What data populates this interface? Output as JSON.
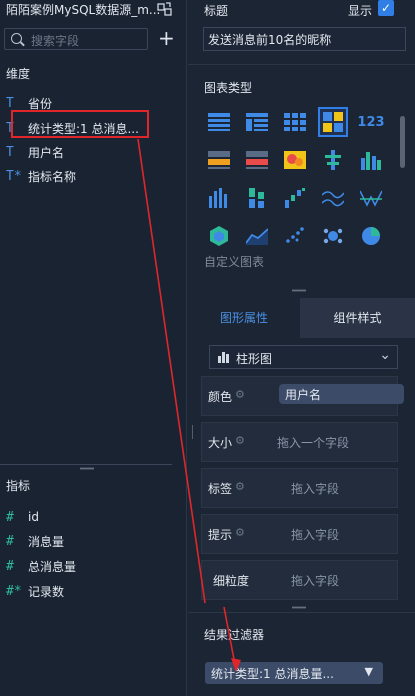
{
  "left_panel": {
    "datasource_title": "陌陌案例MySQL数据源_m...",
    "search_placeholder": "搜索字段",
    "add_label": "+",
    "dimensions_label": "维度",
    "dimensions": [
      {
        "icon": "T",
        "label": "省份"
      },
      {
        "icon": "T",
        "label": "统计类型:1 总消息..."
      },
      {
        "icon": "T",
        "label": "用户名"
      },
      {
        "icon": "T*",
        "label": "指标名称"
      }
    ],
    "measures_label": "指标",
    "measures": [
      {
        "icon": "#",
        "label": "id"
      },
      {
        "icon": "#",
        "label": "消息量"
      },
      {
        "icon": "#",
        "label": "总消息量"
      },
      {
        "icon": "#*",
        "label": "记录数"
      }
    ]
  },
  "right_panel": {
    "title_label": "标题",
    "show_label": "显示",
    "show_checked": true,
    "title_value": "发送消息前10名的昵称",
    "chart_type_label": "图表类型",
    "custom_chart_label": "自定义图表",
    "selected_chart_index": 4,
    "tabs": [
      "图形属性",
      "组件样式"
    ],
    "chart_select_value": "柱形图",
    "shelves": {
      "color_label": "颜色",
      "color_value": "用户名",
      "size_label": "大小",
      "size_hint": "拖入一个字段",
      "label_label": "标签",
      "label_hint": "拖入字段",
      "tip_label": "提示",
      "tip_hint": "拖入字段",
      "granularity_label": "细粒度",
      "granularity_hint": "拖入字段"
    },
    "filter_label": "结果过滤器",
    "filter_value": "统计类型:1 总消息量..."
  },
  "colors": {
    "background": "#1a2332",
    "accent": "#2f7fe6",
    "annotation": "#e0262b"
  }
}
